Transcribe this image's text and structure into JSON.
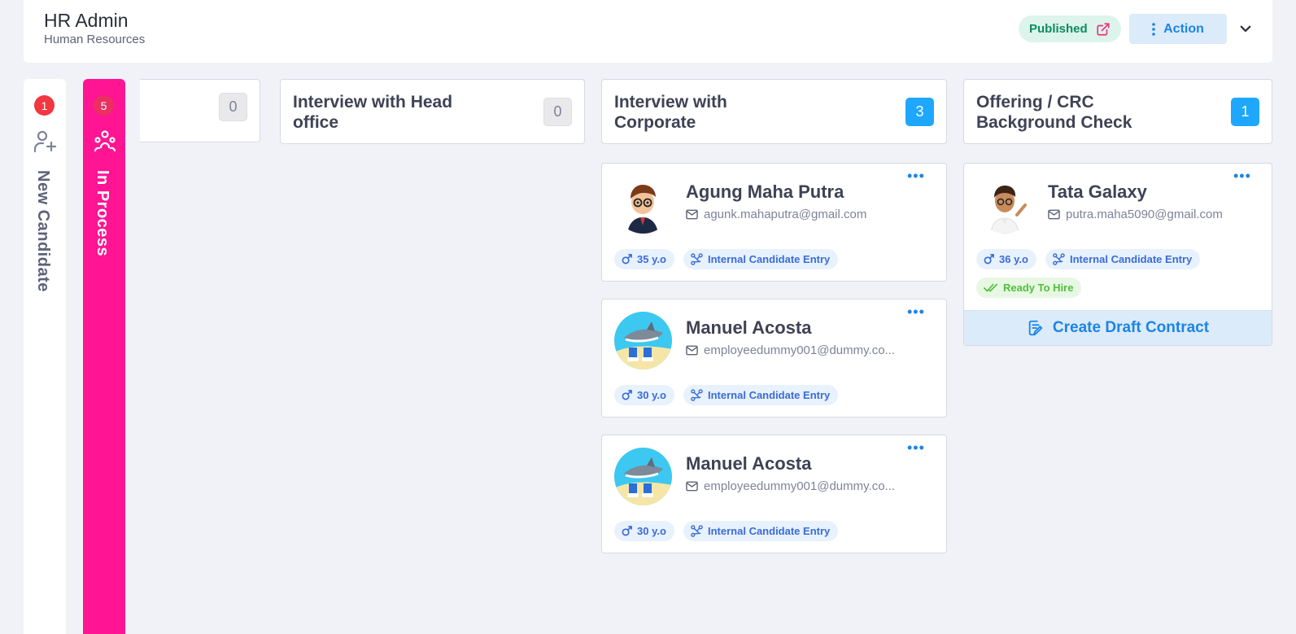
{
  "header": {
    "title": "HR Admin",
    "subtitle": "Human Resources",
    "published_label": "Published",
    "action_label": "Action"
  },
  "side_tabs": [
    {
      "label": "New Candidate",
      "count": "1"
    },
    {
      "label": "In Process",
      "count": "5"
    }
  ],
  "columns": [
    {
      "title": "",
      "count": "0"
    },
    {
      "title": "Interview with Head office",
      "count": "0"
    },
    {
      "title": "Interview with Corporate",
      "count": "3"
    },
    {
      "title": "Offering / CRC Background Check",
      "count": "1"
    }
  ],
  "cards": [
    {
      "name": "Agung Maha Putra",
      "email": "agunk.mahaputra@gmail.com",
      "age": "35 y.o",
      "source": "Internal Candidate Entry"
    },
    {
      "name": "Manuel Acosta",
      "email": "employeedummy001@dummy.co...",
      "age": "30 y.o",
      "source": "Internal Candidate Entry"
    },
    {
      "name": "Manuel Acosta",
      "email": "employeedummy001@dummy.co...",
      "age": "30 y.o",
      "source": "Internal Candidate Entry"
    },
    {
      "name": "Tata Galaxy",
      "email": "putra.maha5090@gmail.com",
      "age": "36 y.o",
      "source": "Internal Candidate Entry",
      "status": "Ready To Hire",
      "button": "Create Draft Contract"
    }
  ],
  "colors": {
    "accent": "#1b84e7",
    "in_process": "#ff1493",
    "badge_red": "#f1373f",
    "count_blue": "#1ea7fd",
    "published_green": "#0f8a5f"
  }
}
